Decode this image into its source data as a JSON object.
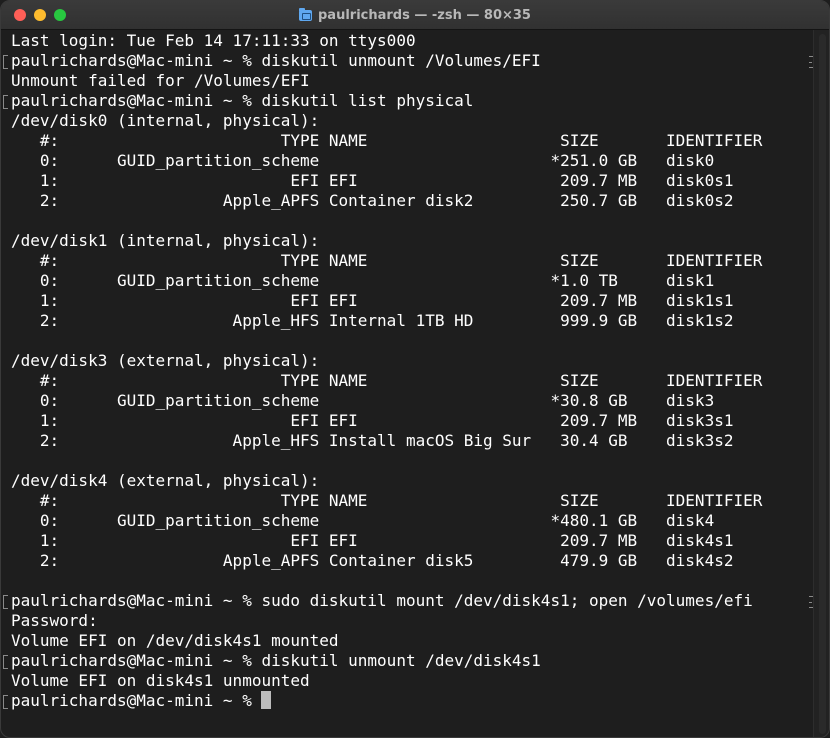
{
  "window": {
    "title": "paulrichards — -zsh — 80×35",
    "folder_icon": "folder-icon",
    "colors": {
      "background": "#1e1e1e",
      "text": "#ffffff",
      "cursor": "#bdbdbd",
      "close": "#ff5f57",
      "minimize": "#febc2e",
      "maximize": "#28c840"
    }
  },
  "terminal": {
    "lines": [
      "Last login: Tue Feb 14 17:11:33 on ttys000",
      "paulrichards@Mac-mini ~ % diskutil unmount /Volumes/EFI",
      "Unmount failed for /Volumes/EFI",
      "paulrichards@Mac-mini ~ % diskutil list physical",
      "/dev/disk0 (internal, physical):",
      "   #:                       TYPE NAME                    SIZE       IDENTIFIER",
      "   0:      GUID_partition_scheme                        *251.0 GB   disk0",
      "   1:                        EFI EFI                     209.7 MB   disk0s1",
      "   2:                 Apple_APFS Container disk2         250.7 GB   disk0s2",
      "",
      "/dev/disk1 (internal, physical):",
      "   #:                       TYPE NAME                    SIZE       IDENTIFIER",
      "   0:      GUID_partition_scheme                        *1.0 TB     disk1",
      "   1:                        EFI EFI                     209.7 MB   disk1s1",
      "   2:                  Apple_HFS Internal 1TB HD         999.9 GB   disk1s2",
      "",
      "/dev/disk3 (external, physical):",
      "   #:                       TYPE NAME                    SIZE       IDENTIFIER",
      "   0:      GUID_partition_scheme                        *30.8 GB    disk3",
      "   1:                        EFI EFI                     209.7 MB   disk3s1",
      "   2:                  Apple_HFS Install macOS Big Sur   30.4 GB    disk3s2",
      "",
      "/dev/disk4 (external, physical):",
      "   #:                       TYPE NAME                    SIZE       IDENTIFIER",
      "   0:      GUID_partition_scheme                        *480.1 GB   disk4",
      "   1:                        EFI EFI                     209.7 MB   disk4s1",
      "   2:                 Apple_APFS Container disk5         479.9 GB   disk4s2",
      "",
      "paulrichards@Mac-mini ~ % sudo diskutil mount /dev/disk4s1; open /volumes/efi",
      "Password:",
      "Volume EFI on /dev/disk4s1 mounted",
      "paulrichards@Mac-mini ~ % diskutil unmount /dev/disk4s1",
      "Volume EFI on disk4s1 unmounted",
      "paulrichards@Mac-mini ~ % "
    ]
  }
}
